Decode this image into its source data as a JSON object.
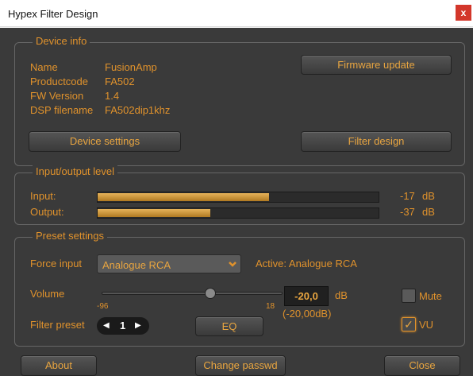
{
  "window": {
    "title": "Hypex Filter Design",
    "close_glyph": "x"
  },
  "device_info": {
    "legend": "Device info",
    "rows": [
      {
        "label": "Name",
        "value": "FusionAmp"
      },
      {
        "label": "Productcode",
        "value": "FA502"
      },
      {
        "label": "FW Version",
        "value": "1.4"
      },
      {
        "label": "DSP filename",
        "value": "FA502dip1khz"
      }
    ],
    "firmware_button": "Firmware update",
    "device_settings_button": "Device settings",
    "filter_design_button": "Filter design"
  },
  "io_level": {
    "legend": "Input/output level",
    "input": {
      "label": "Input:",
      "value": "-17",
      "unit": "dB",
      "fill_fraction": 0.61
    },
    "output": {
      "label": "Output:",
      "value": "-37",
      "unit": "dB",
      "fill_fraction": 0.4
    }
  },
  "preset": {
    "legend": "Preset settings",
    "force_input_label": "Force input",
    "force_input_value": "Analogue RCA",
    "active_text": "Active: Analogue RCA",
    "volume_label": "Volume",
    "volume_min": "-96",
    "volume_max": "18",
    "volume_value": "-20,0",
    "volume_unit": "dB",
    "volume_exact": "(-20,00dB)",
    "mute_label": "Mute",
    "mute_checked": false,
    "filter_preset_label": "Filter preset",
    "filter_preset_value": "1",
    "eq_button": "EQ",
    "vu_label": "VU",
    "vu_checked": true
  },
  "footer": {
    "about_button": "About",
    "change_passwd_button": "Change passwd",
    "close_button": "Close"
  },
  "colors": {
    "accent": "#e0922c",
    "background": "#3a3a3a",
    "close": "#d3372b"
  },
  "icons": {
    "close": "close-icon",
    "dropdown": "chevron-down-icon",
    "stepper_left": "triangle-left-icon",
    "stepper_right": "triangle-right-icon",
    "check": "checkmark-icon"
  }
}
